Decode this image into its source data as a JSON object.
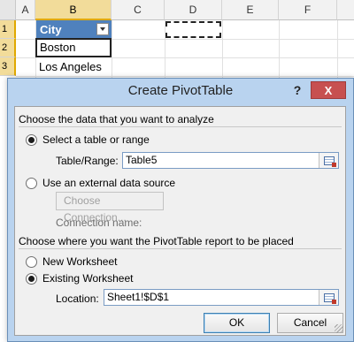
{
  "sheet": {
    "columns": [
      "A",
      "B",
      "C",
      "D",
      "E",
      "F"
    ],
    "rows": [
      "1",
      "2",
      "3"
    ],
    "cells": {
      "b1": "City",
      "b2": "Boston",
      "b3": "Los Angeles"
    }
  },
  "dialog": {
    "title": "Create PivotTable",
    "help_label": "?",
    "close_label": "X",
    "section1_title": "Choose the data that you want to analyze",
    "radio_table": "Select a table or range",
    "table_range_label": "Table/Range:",
    "table_range_value": "Table5",
    "radio_external": "Use an external data source",
    "choose_connection_label": "Choose Connection...",
    "connection_name_label": "Connection name:",
    "section2_title": "Choose where you want the PivotTable report to be placed",
    "radio_new": "New Worksheet",
    "radio_existing": "Existing Worksheet",
    "location_label": "Location:",
    "location_value": "Sheet1!$D$1",
    "ok_label": "OK",
    "cancel_label": "Cancel"
  },
  "icons": {
    "collapse_dialog": "collapse-dialog-icon",
    "dropdown": "filter-dropdown-icon"
  }
}
